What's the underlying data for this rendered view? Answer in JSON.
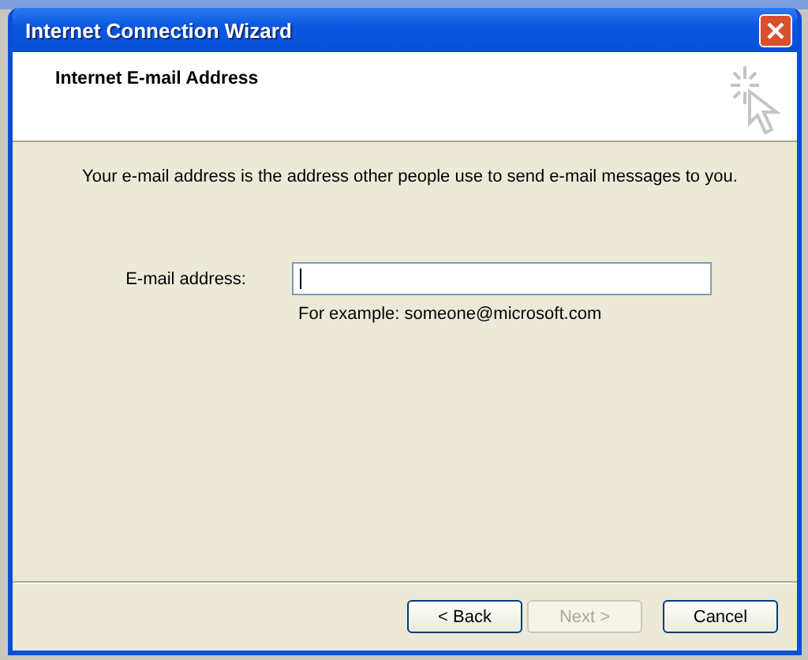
{
  "window": {
    "title": "Internet Connection Wizard"
  },
  "header": {
    "title": "Internet E-mail Address"
  },
  "description": "Your e-mail address is the address other people use to send e-mail messages to you.",
  "email_field": {
    "label": "E-mail address:",
    "focused": true,
    "example": "For example: someone@microsoft.com"
  },
  "buttons": [
    {
      "label": "< Back",
      "disabled": false,
      "default": false
    },
    {
      "label": "Next >",
      "disabled": true,
      "default": false
    },
    {
      "label": "Cancel",
      "disabled": false,
      "default": false
    }
  ]
}
